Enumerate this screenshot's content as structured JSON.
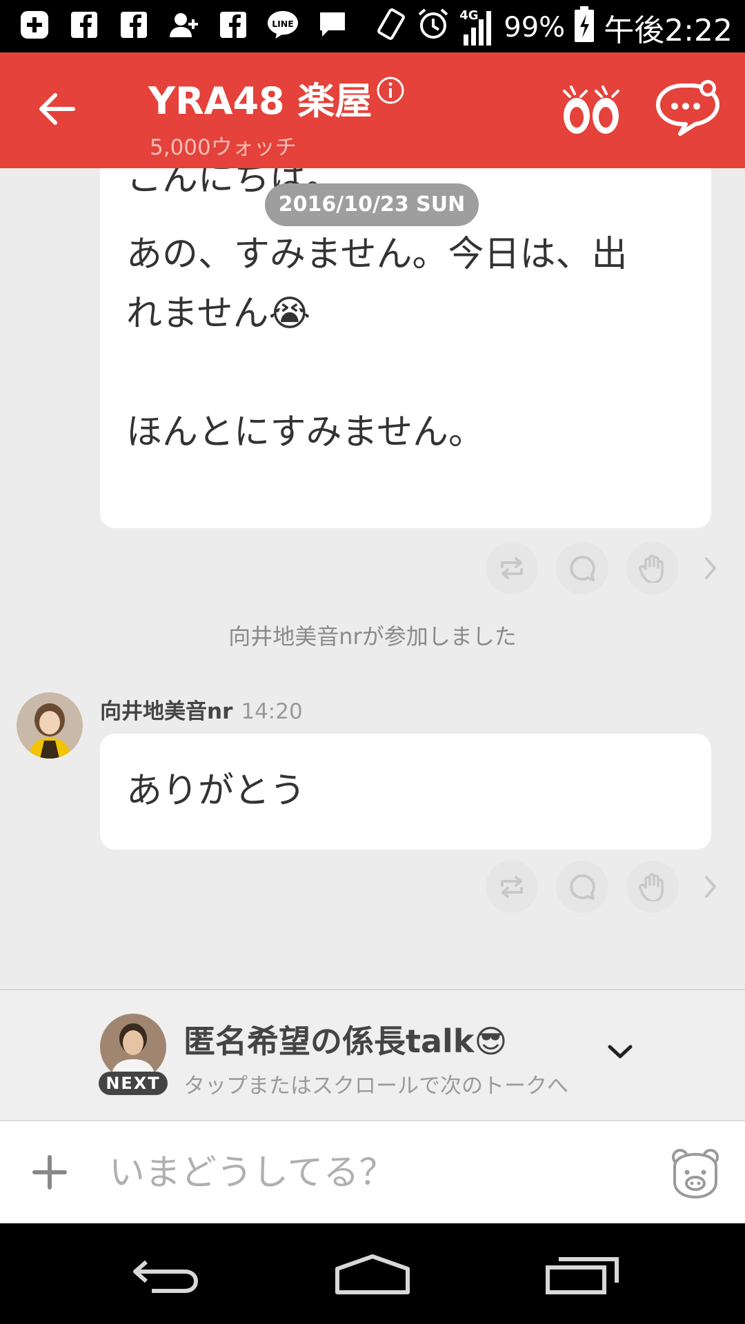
{
  "status_bar": {
    "icons": [
      "plus-box-icon",
      "facebook-icon",
      "facebook-icon",
      "person-add-icon",
      "facebook-icon",
      "line-icon",
      "message-icon"
    ],
    "line_label": "LINE",
    "network": "4G",
    "battery": "99%",
    "time": "午後2:22"
  },
  "header": {
    "title": "YRA48 楽屋",
    "watchers": "5,000ウォッチ",
    "color": "#e4423a"
  },
  "messages": [
    {
      "cut_text": "こんにちは。",
      "lines": [
        "あの、すみません。今日は、出",
        "れません😭",
        "ほんとにすみません。"
      ]
    },
    {
      "sender": "向井地美音nr",
      "time": "14:20",
      "text": "ありがとう"
    }
  ],
  "date_pill": "2016/10/23 SUN",
  "system_message": "向井地美音nrが参加しました",
  "next_talk": {
    "badge": "NEXT",
    "title": "匿名希望の係長talk😎",
    "subtitle": "タップまたはスクロールで次のトークへ"
  },
  "input": {
    "placeholder": "いまどうしてる？"
  }
}
